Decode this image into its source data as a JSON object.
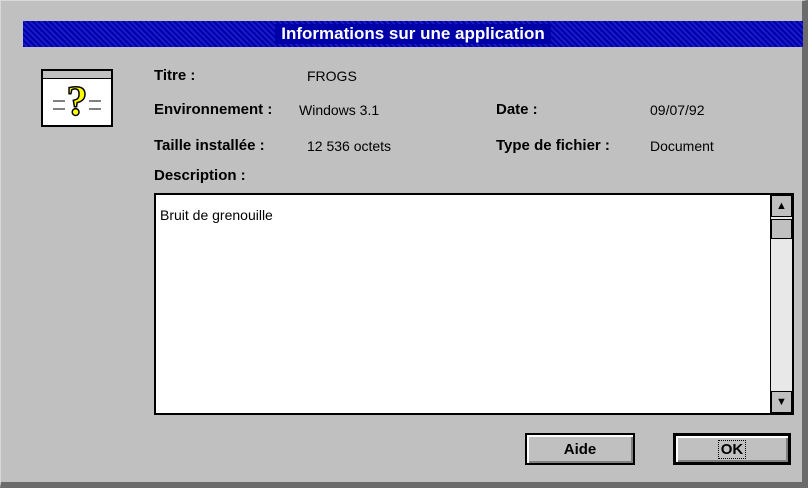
{
  "window": {
    "title": "Informations sur une application"
  },
  "icons": {
    "app": "question-mark-document-icon",
    "scroll_up": "arrow-up-icon",
    "scroll_down": "arrow-down-icon"
  },
  "fields": {
    "titre_label": "Titre :",
    "titre_value": "FROGS",
    "env_label": "Environnement :",
    "env_value": "Windows 3.1",
    "date_label": "Date :",
    "date_value": "09/07/92",
    "taille_label": "Taille installée :",
    "taille_value": "12 536 octets",
    "type_label": "Type de fichier :",
    "type_value": "Document"
  },
  "description": {
    "label": "Description :",
    "text": "Bruit de grenouille"
  },
  "buttons": {
    "help": "Aide",
    "ok": "OK"
  },
  "colors": {
    "titlebar": "#0000a8",
    "face": "#c0c0c0",
    "icon_question": "#ffff00"
  }
}
